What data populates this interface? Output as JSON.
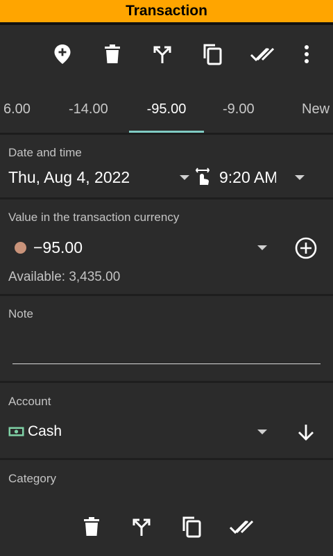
{
  "window": {
    "title": "Transaction"
  },
  "toolbar": {
    "icons": [
      "add-location-icon",
      "delete-icon",
      "split-icon",
      "copy-icon",
      "done-all-icon",
      "more-vert-icon"
    ]
  },
  "tabs": {
    "items": [
      {
        "label": "6.00"
      },
      {
        "label": "-14.00"
      },
      {
        "label": "-95.00",
        "active": true
      },
      {
        "label": "-9.00"
      },
      {
        "label": "New"
      }
    ],
    "indicator_color": "#80cbc4"
  },
  "datetime": {
    "label": "Date and time",
    "date": "Thu, Aug 4, 2022",
    "time": "9:20 AM"
  },
  "value": {
    "label": "Value in the transaction currency",
    "amount": "−95.00",
    "available": "Available: 3,435.00",
    "dot_color": "#c9937a"
  },
  "note": {
    "label": "Note",
    "value": ""
  },
  "account": {
    "label": "Account",
    "name": "Cash",
    "icon_color": "#7fd1a6"
  },
  "category": {
    "label": "Category"
  },
  "bottombar": {
    "icons": [
      "delete-icon",
      "split-icon",
      "copy-icon",
      "done-all-icon"
    ]
  },
  "colors": {
    "title_bg": "#ffa500",
    "surface": "#2b2b2b",
    "background": "#1e1e1e"
  }
}
